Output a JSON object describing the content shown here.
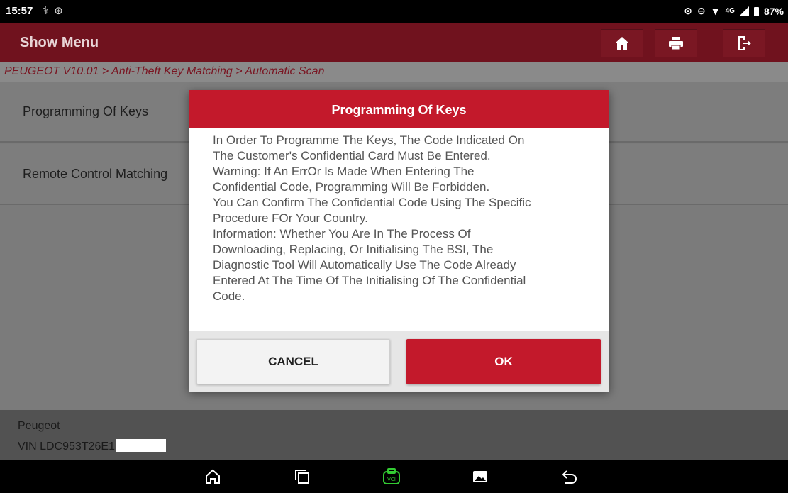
{
  "status_bar": {
    "time": "15:57",
    "left_icons": [
      "usb-debug-icon",
      "bluetooth-icon"
    ],
    "network": "4G",
    "battery": "87%"
  },
  "header": {
    "title": "Show Menu",
    "buttons": [
      "home-icon",
      "print-icon",
      "exit-icon"
    ]
  },
  "breadcrumb": "PEUGEOT V10.01 > Anti-Theft Key Matching > Automatic Scan",
  "menu": {
    "items": [
      {
        "label": "Programming Of Keys"
      },
      {
        "label": "Remote Control Matching"
      }
    ]
  },
  "dialog": {
    "title": "Programming Of Keys",
    "lines": [
      "In Order To Programme The Keys, The Code Indicated On",
      "The Customer's Confidential Card Must Be Entered.",
      "Warning: If An ErrOr Is Made When Entering The",
      "Confidential Code, Programming Will Be Forbidden.",
      "You Can Confirm The Confidential Code Using The Specific",
      "Procedure FOr Your Country.",
      "Information: Whether You Are In The Process Of",
      "Downloading, Replacing, Or Initialising The BSI, The",
      "Diagnostic Tool Will Automatically Use The Code Already",
      "Entered At The Time Of The Initialising Of The Confidential",
      "Code."
    ],
    "cancel_label": "CANCEL",
    "ok_label": "OK"
  },
  "vehicle": {
    "make": "Peugeot",
    "vin": "VIN LDC953T26E1"
  },
  "navbar": {
    "buttons": [
      "home-icon",
      "recent-apps-icon",
      "vci-icon",
      "gallery-icon",
      "back-icon"
    ]
  },
  "colors": {
    "accent_red": "#c3192b",
    "title_bar": "#70121e",
    "vci_green": "#33cc33"
  }
}
